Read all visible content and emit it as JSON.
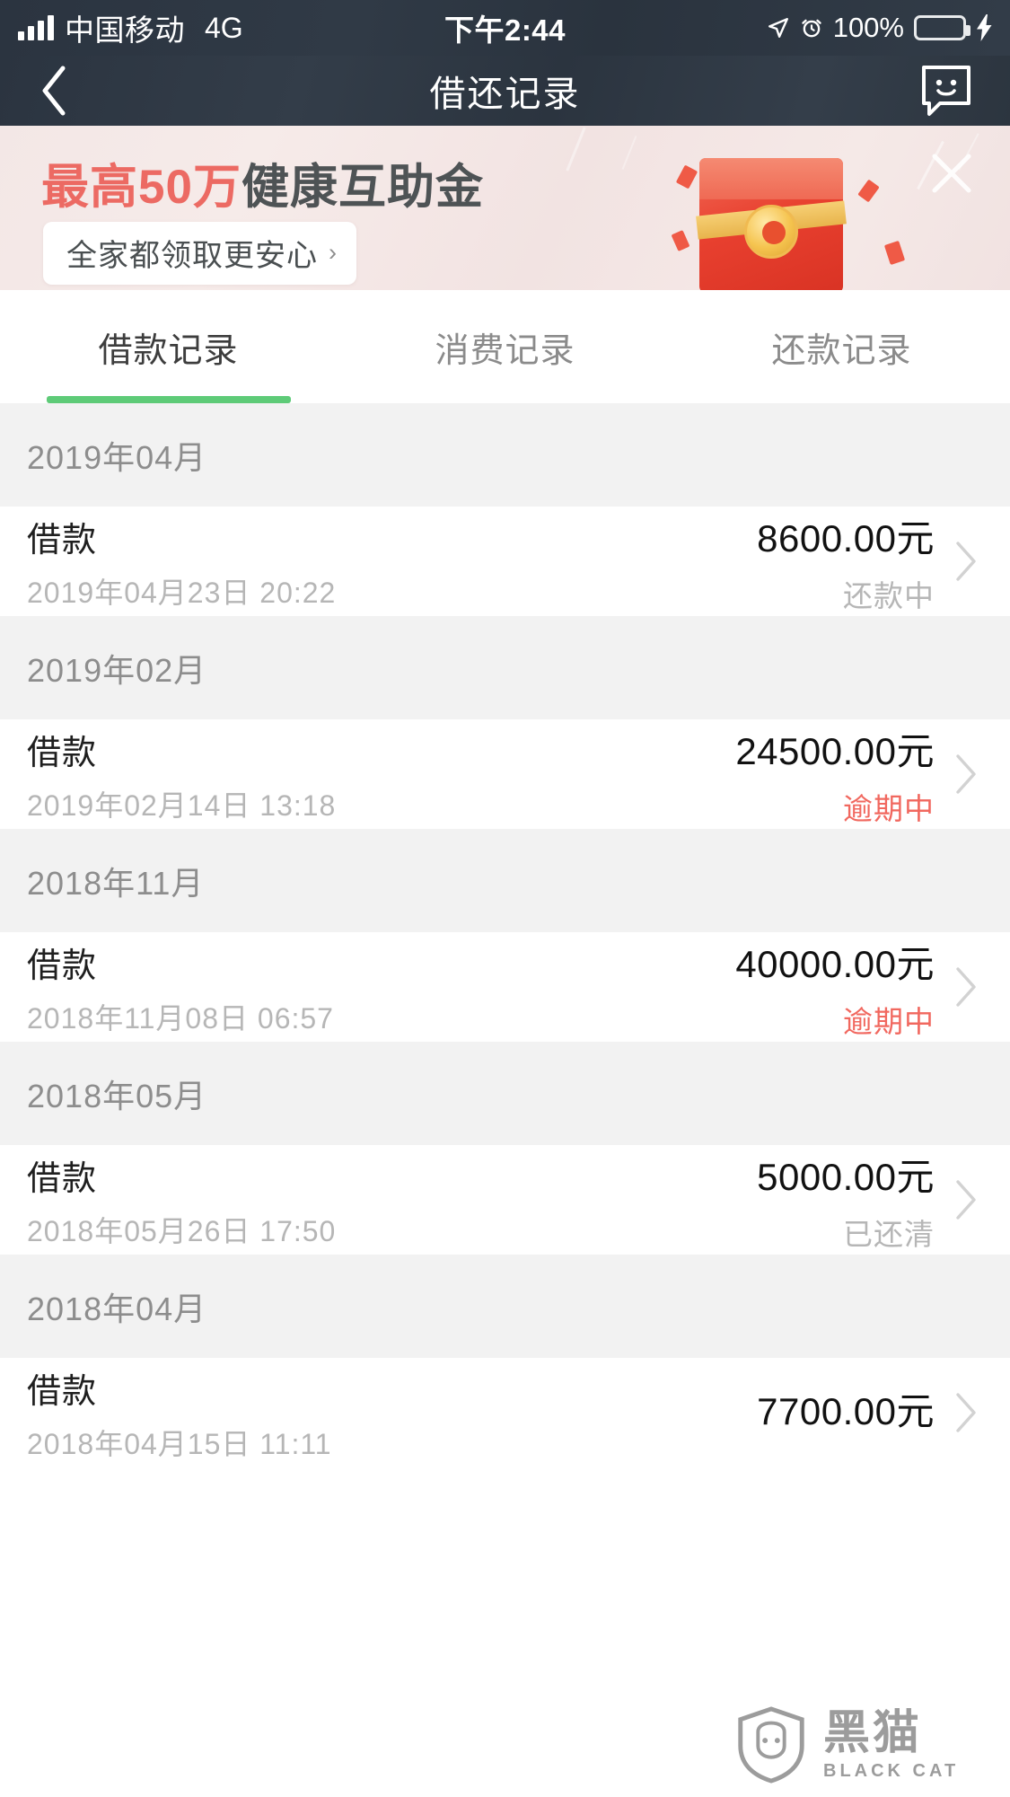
{
  "status_bar": {
    "carrier": "中国移动",
    "network": "4G",
    "time": "下午2:44",
    "battery_percent": "100%",
    "icons": [
      "signal-bars-icon",
      "location-arrow-icon",
      "alarm-clock-icon",
      "battery-icon",
      "charging-bolt-icon"
    ]
  },
  "nav": {
    "back_icon": "chevron-left-icon",
    "title": "借还记录",
    "chat_icon": "chat-smiley-icon"
  },
  "banner": {
    "headline_highlight": "最高50万",
    "headline_rest": "健康互助金",
    "cta_label": "全家都领取更安心",
    "cta_chevron": "›",
    "highlight_color": "#ec6a63",
    "text_color": "#4e5355",
    "background_color": "#f3e7e6",
    "art": "red-envelope-icon",
    "close_icon": "close-icon"
  },
  "tabs": {
    "items": [
      {
        "label": "借款记录",
        "active": true
      },
      {
        "label": "消费记录",
        "active": false
      },
      {
        "label": "还款记录",
        "active": false
      }
    ],
    "indicator_color": "#5ecb78"
  },
  "groups": [
    {
      "month": "2019年04月",
      "rows": [
        {
          "title": "借款",
          "date": "2019年04月23日 20:22",
          "amount": "8600.00元",
          "status": "还款中",
          "status_kind": "normal"
        }
      ]
    },
    {
      "month": "2019年02月",
      "rows": [
        {
          "title": "借款",
          "date": "2019年02月14日 13:18",
          "amount": "24500.00元",
          "status": "逾期中",
          "status_kind": "overdue"
        }
      ]
    },
    {
      "month": "2018年11月",
      "rows": [
        {
          "title": "借款",
          "date": "2018年11月08日 06:57",
          "amount": "40000.00元",
          "status": "逾期中",
          "status_kind": "overdue"
        }
      ]
    },
    {
      "month": "2018年05月",
      "rows": [
        {
          "title": "借款",
          "date": "2018年05月26日 17:50",
          "amount": "5000.00元",
          "status": "已还清",
          "status_kind": "normal"
        }
      ]
    },
    {
      "month": "2018年04月",
      "rows": [
        {
          "title": "借款",
          "date": "2018年04月15日 11:11",
          "amount": "7700.00元",
          "status": "",
          "status_kind": "normal"
        }
      ]
    }
  ],
  "watermark": {
    "cn": "黑猫",
    "en": "BLACK CAT",
    "icon": "shield-cat-icon"
  },
  "colors": {
    "status_overdue": "#f1685f",
    "status_normal": "#b6b6b6",
    "accent_green": "#5ecb78",
    "navbar": "#2b3440"
  }
}
